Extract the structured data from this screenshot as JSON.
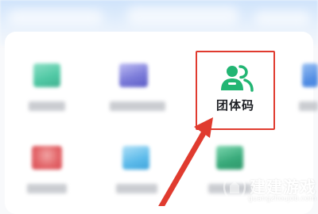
{
  "grid": {
    "highlighted_item": {
      "icon": "group-people-icon",
      "label": "团体码",
      "icon_color": "#22b573",
      "highlight_color": "#e03b2f"
    },
    "blurred_items": [
      {
        "icon_color": "#3cc29a"
      },
      {
        "icon_color": "#6f6fd6"
      },
      {
        "icon_color": "#3d7fe0"
      },
      {
        "icon_color": "#e0565a"
      },
      {
        "icon_color": "#4ab3e8"
      },
      {
        "icon_color": "#22a06b"
      }
    ]
  },
  "annotation": {
    "arrow_color": "#e03b2f"
  },
  "watermark": {
    "title": "建建游戏",
    "url": "guangzhoujob.com"
  }
}
